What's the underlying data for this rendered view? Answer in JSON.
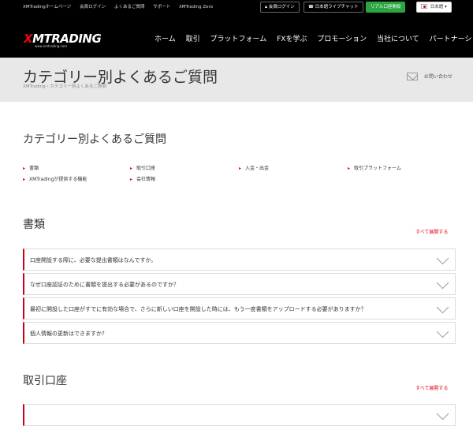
{
  "topbar": {
    "links": [
      "XMTradingホームページ",
      "会員ログイン",
      "よくあるご質問",
      "サポート",
      "XMTrading Zero"
    ],
    "member_login": "会員ログイン",
    "live_chat": "日本語ライブチャット",
    "open_account": "リアル口座開設",
    "language": "日本語"
  },
  "brand": {
    "logo_x": "X",
    "logo_rest": "MTRADING",
    "url": "www.xmtrading.com"
  },
  "nav": [
    "ホーム",
    "取引",
    "プラットフォーム",
    "FXを学ぶ",
    "プロモーション",
    "当社について",
    "パートナーシップ"
  ],
  "banner": {
    "title": "カテゴリー別よくあるご質問",
    "breadcrumb": "XMTrading  ›  カテゴリー別よくあるご質問",
    "contact": "お問い合わせ"
  },
  "categories_section": {
    "heading": "カテゴリー別よくあるご質問",
    "items": [
      "書類",
      "取引口座",
      "入金・出金",
      "取引プラットフォーム",
      "XMTradingが提供する機能",
      "会社情報"
    ]
  },
  "documents_section": {
    "heading": "書類",
    "expand_all": "すべて展開する",
    "questions": [
      "口座開設する際に、必要な提出書類はなんですか。",
      "なぜ口座認証のために書類を提出する必要があるのですか？",
      "最初に開設した口座がすでに有効な場合で、さらに新しい口座を開設した時には、もう一度書類をアップロードする必要がありますか？",
      "個人情報の更新はできますか?"
    ]
  },
  "accounts_section": {
    "heading": "取引口座",
    "expand_all": "すべて展開する"
  }
}
